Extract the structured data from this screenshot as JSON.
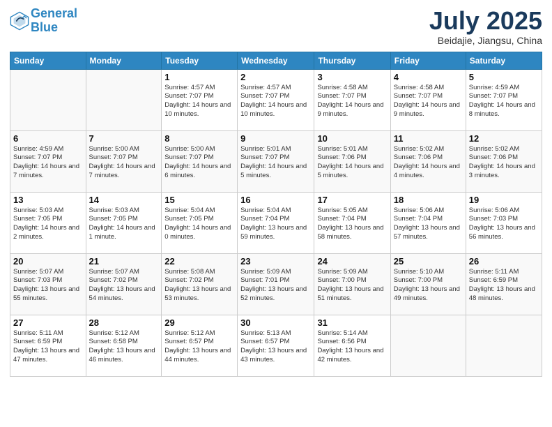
{
  "header": {
    "logo_line1": "General",
    "logo_line2": "Blue",
    "month_title": "July 2025",
    "location": "Beidajie, Jiangsu, China"
  },
  "weekdays": [
    "Sunday",
    "Monday",
    "Tuesday",
    "Wednesday",
    "Thursday",
    "Friday",
    "Saturday"
  ],
  "weeks": [
    [
      {
        "day": "",
        "info": ""
      },
      {
        "day": "",
        "info": ""
      },
      {
        "day": "1",
        "info": "Sunrise: 4:57 AM\nSunset: 7:07 PM\nDaylight: 14 hours\nand 10 minutes."
      },
      {
        "day": "2",
        "info": "Sunrise: 4:57 AM\nSunset: 7:07 PM\nDaylight: 14 hours\nand 10 minutes."
      },
      {
        "day": "3",
        "info": "Sunrise: 4:58 AM\nSunset: 7:07 PM\nDaylight: 14 hours\nand 9 minutes."
      },
      {
        "day": "4",
        "info": "Sunrise: 4:58 AM\nSunset: 7:07 PM\nDaylight: 14 hours\nand 9 minutes."
      },
      {
        "day": "5",
        "info": "Sunrise: 4:59 AM\nSunset: 7:07 PM\nDaylight: 14 hours\nand 8 minutes."
      }
    ],
    [
      {
        "day": "6",
        "info": "Sunrise: 4:59 AM\nSunset: 7:07 PM\nDaylight: 14 hours\nand 7 minutes."
      },
      {
        "day": "7",
        "info": "Sunrise: 5:00 AM\nSunset: 7:07 PM\nDaylight: 14 hours\nand 7 minutes."
      },
      {
        "day": "8",
        "info": "Sunrise: 5:00 AM\nSunset: 7:07 PM\nDaylight: 14 hours\nand 6 minutes."
      },
      {
        "day": "9",
        "info": "Sunrise: 5:01 AM\nSunset: 7:07 PM\nDaylight: 14 hours\nand 5 minutes."
      },
      {
        "day": "10",
        "info": "Sunrise: 5:01 AM\nSunset: 7:06 PM\nDaylight: 14 hours\nand 5 minutes."
      },
      {
        "day": "11",
        "info": "Sunrise: 5:02 AM\nSunset: 7:06 PM\nDaylight: 14 hours\nand 4 minutes."
      },
      {
        "day": "12",
        "info": "Sunrise: 5:02 AM\nSunset: 7:06 PM\nDaylight: 14 hours\nand 3 minutes."
      }
    ],
    [
      {
        "day": "13",
        "info": "Sunrise: 5:03 AM\nSunset: 7:05 PM\nDaylight: 14 hours\nand 2 minutes."
      },
      {
        "day": "14",
        "info": "Sunrise: 5:03 AM\nSunset: 7:05 PM\nDaylight: 14 hours\nand 1 minute."
      },
      {
        "day": "15",
        "info": "Sunrise: 5:04 AM\nSunset: 7:05 PM\nDaylight: 14 hours\nand 0 minutes."
      },
      {
        "day": "16",
        "info": "Sunrise: 5:04 AM\nSunset: 7:04 PM\nDaylight: 13 hours\nand 59 minutes."
      },
      {
        "day": "17",
        "info": "Sunrise: 5:05 AM\nSunset: 7:04 PM\nDaylight: 13 hours\nand 58 minutes."
      },
      {
        "day": "18",
        "info": "Sunrise: 5:06 AM\nSunset: 7:04 PM\nDaylight: 13 hours\nand 57 minutes."
      },
      {
        "day": "19",
        "info": "Sunrise: 5:06 AM\nSunset: 7:03 PM\nDaylight: 13 hours\nand 56 minutes."
      }
    ],
    [
      {
        "day": "20",
        "info": "Sunrise: 5:07 AM\nSunset: 7:03 PM\nDaylight: 13 hours\nand 55 minutes."
      },
      {
        "day": "21",
        "info": "Sunrise: 5:07 AM\nSunset: 7:02 PM\nDaylight: 13 hours\nand 54 minutes."
      },
      {
        "day": "22",
        "info": "Sunrise: 5:08 AM\nSunset: 7:02 PM\nDaylight: 13 hours\nand 53 minutes."
      },
      {
        "day": "23",
        "info": "Sunrise: 5:09 AM\nSunset: 7:01 PM\nDaylight: 13 hours\nand 52 minutes."
      },
      {
        "day": "24",
        "info": "Sunrise: 5:09 AM\nSunset: 7:00 PM\nDaylight: 13 hours\nand 51 minutes."
      },
      {
        "day": "25",
        "info": "Sunrise: 5:10 AM\nSunset: 7:00 PM\nDaylight: 13 hours\nand 49 minutes."
      },
      {
        "day": "26",
        "info": "Sunrise: 5:11 AM\nSunset: 6:59 PM\nDaylight: 13 hours\nand 48 minutes."
      }
    ],
    [
      {
        "day": "27",
        "info": "Sunrise: 5:11 AM\nSunset: 6:59 PM\nDaylight: 13 hours\nand 47 minutes."
      },
      {
        "day": "28",
        "info": "Sunrise: 5:12 AM\nSunset: 6:58 PM\nDaylight: 13 hours\nand 46 minutes."
      },
      {
        "day": "29",
        "info": "Sunrise: 5:12 AM\nSunset: 6:57 PM\nDaylight: 13 hours\nand 44 minutes."
      },
      {
        "day": "30",
        "info": "Sunrise: 5:13 AM\nSunset: 6:57 PM\nDaylight: 13 hours\nand 43 minutes."
      },
      {
        "day": "31",
        "info": "Sunrise: 5:14 AM\nSunset: 6:56 PM\nDaylight: 13 hours\nand 42 minutes."
      },
      {
        "day": "",
        "info": ""
      },
      {
        "day": "",
        "info": ""
      }
    ]
  ]
}
